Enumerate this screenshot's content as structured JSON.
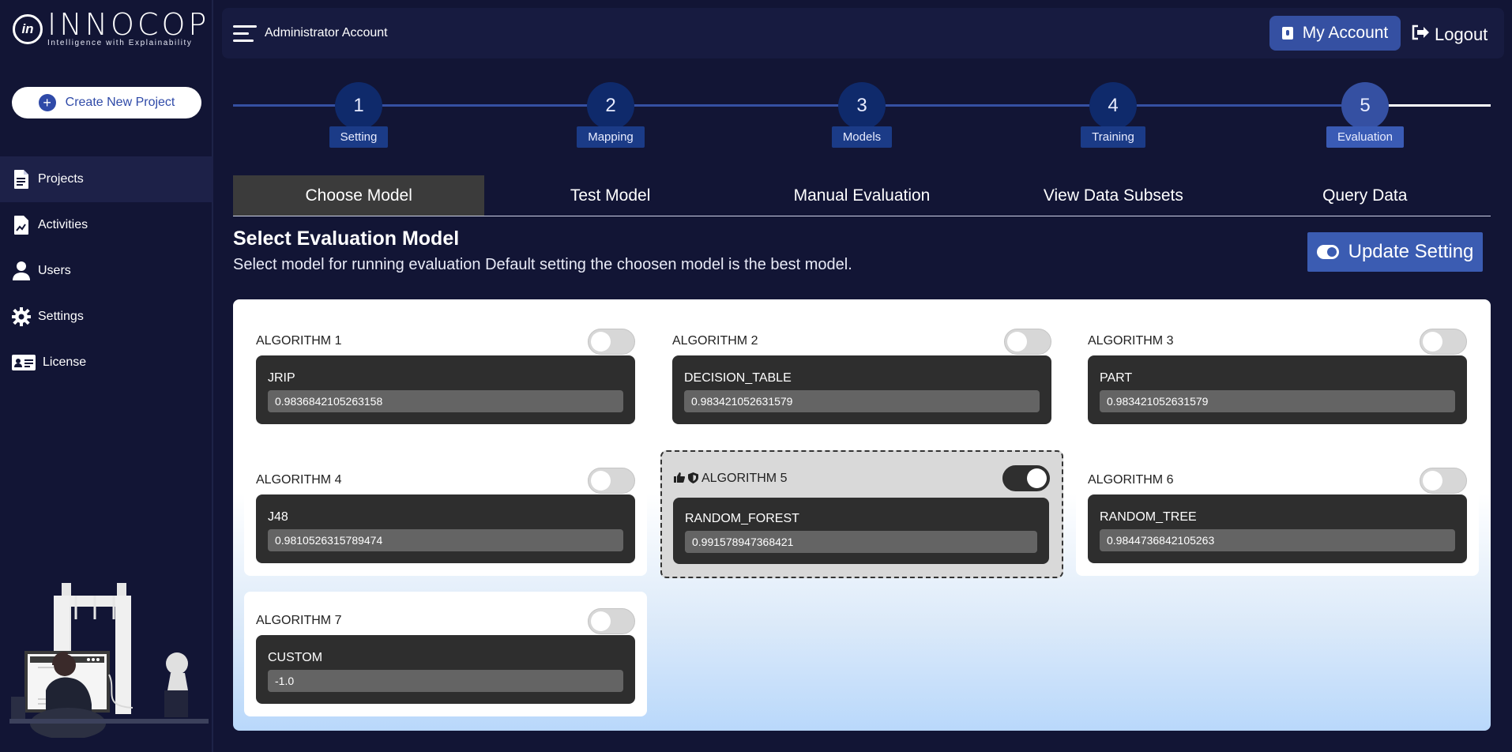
{
  "app": {
    "logo_mark": "in",
    "logo_title": "INNOCOP",
    "logo_tagline": "Intelligence with Explainability",
    "create_project": "Create New Project"
  },
  "sidebar": {
    "items": [
      {
        "label": "Projects",
        "icon": "document-icon",
        "active": true
      },
      {
        "label": "Activities",
        "icon": "activity-chart-icon",
        "active": false
      },
      {
        "label": "Users",
        "icon": "user-icon",
        "active": false
      },
      {
        "label": "Settings",
        "icon": "gear-icon",
        "active": false
      },
      {
        "label": "License",
        "icon": "id-card-icon",
        "active": false
      }
    ]
  },
  "header": {
    "account_name": "Administrator Account",
    "my_account": "My Account",
    "logout": "Logout"
  },
  "stepper": {
    "steps": [
      {
        "number": "1",
        "label": "Setting"
      },
      {
        "number": "2",
        "label": "Mapping"
      },
      {
        "number": "3",
        "label": "Models"
      },
      {
        "number": "4",
        "label": "Training"
      },
      {
        "number": "5",
        "label": "Evaluation"
      }
    ],
    "active_step": 5
  },
  "tabs": [
    {
      "label": "Choose Model",
      "active": true
    },
    {
      "label": "Test Model",
      "active": false
    },
    {
      "label": "Manual Evaluation",
      "active": false
    },
    {
      "label": "View Data Subsets",
      "active": false
    },
    {
      "label": "Query Data",
      "active": false
    }
  ],
  "section": {
    "title": "Select Evaluation Model",
    "description": "Select model for running evaluation Default setting the choosen model is the best model.",
    "update_button": "Update Setting"
  },
  "algorithms": [
    {
      "title": "ALGORITHM 1",
      "model": "JRIP",
      "value": "0.9836842105263158",
      "enabled": false
    },
    {
      "title": "ALGORITHM 2",
      "model": "DECISION_TABLE",
      "value": "0.983421052631579",
      "enabled": false
    },
    {
      "title": "ALGORITHM 3",
      "model": "PART",
      "value": "0.983421052631579",
      "enabled": false
    },
    {
      "title": "ALGORITHM 4",
      "model": "J48",
      "value": "0.9810526315789474",
      "enabled": false
    },
    {
      "title": "ALGORITHM 5",
      "model": "RANDOM_FOREST",
      "value": "0.991578947368421",
      "enabled": true
    },
    {
      "title": "ALGORITHM 6",
      "model": "RANDOM_TREE",
      "value": "0.9844736842105263",
      "enabled": false
    },
    {
      "title": "ALGORITHM 7",
      "model": "CUSTOM",
      "value": "-1.0",
      "enabled": false
    }
  ],
  "colors": {
    "background": "#121535",
    "accent": "#3550a2",
    "step_circle": "#0f2a6b",
    "card_body": "#2e2e2e"
  }
}
